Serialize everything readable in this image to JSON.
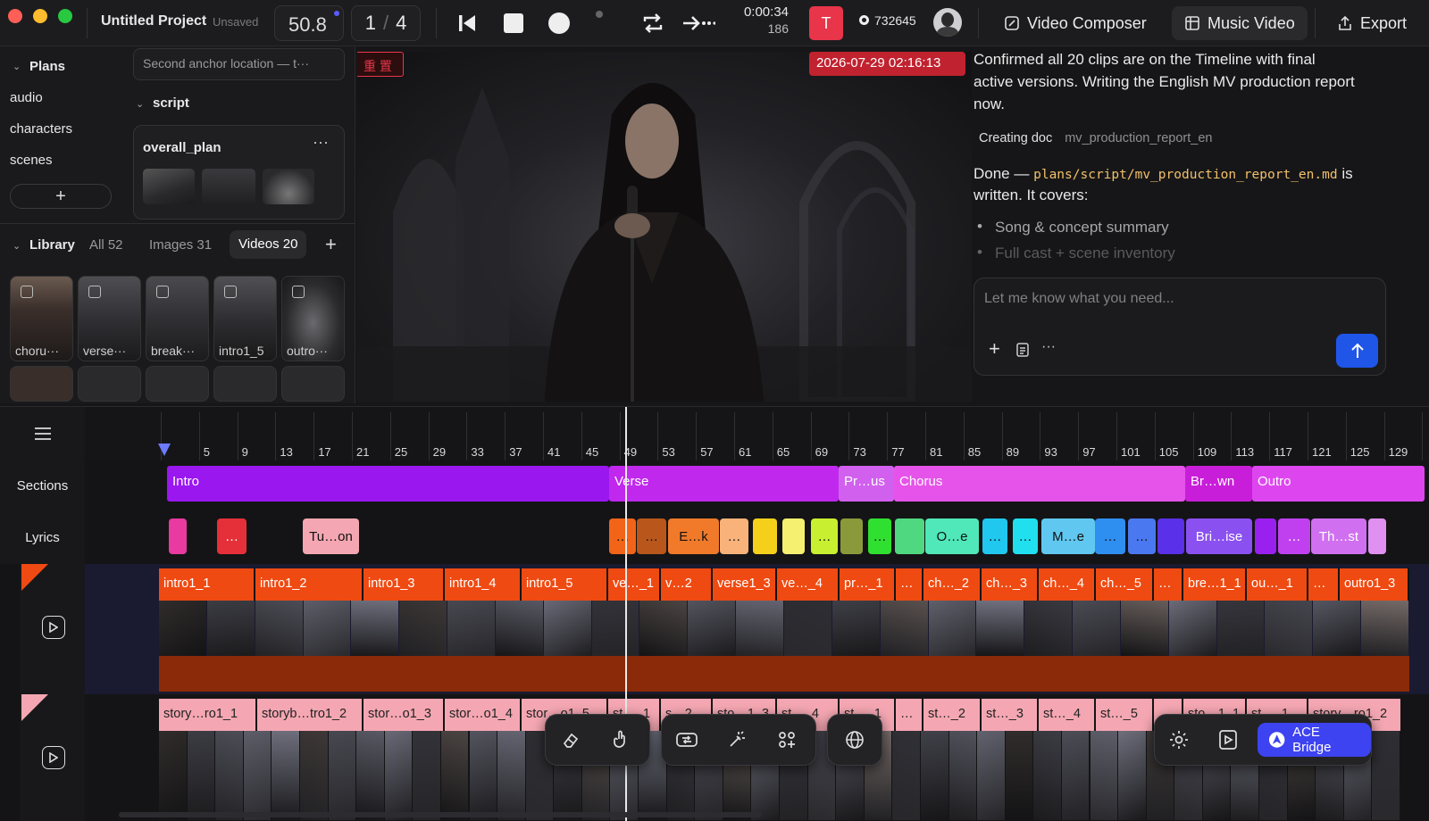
{
  "window": {
    "project_title": "Untitled Project",
    "save_status": "Unsaved",
    "fps": "50.8",
    "page_current": "1",
    "page_sep": "/",
    "page_total": "4",
    "time": "0:00:34",
    "frame": "186",
    "avatar_letter": "T",
    "credits": "732645"
  },
  "tabs": [
    {
      "label": "Video Composer",
      "icon": "composer-icon"
    },
    {
      "label": "Music Video",
      "icon": "grid-icon"
    }
  ],
  "export_label": "Export",
  "sidebar": {
    "search_placeholder": "Second anchor location — t···",
    "plans_label": "Plans",
    "plan_items": [
      "audio",
      "characters",
      "scenes"
    ],
    "script_label": "script",
    "overall_plan_label": "overall_plan",
    "library_label": "Library",
    "filters": [
      "All 52",
      "Images 31",
      "Videos 20"
    ],
    "thumbs": [
      "choru···",
      "verse···",
      "break···",
      "intro1_5",
      "outro···"
    ]
  },
  "preview": {
    "badge": "重 置",
    "timestamp": "2026-07-29 02:16:13"
  },
  "chat": {
    "message1": "Confirmed all 20 clips are on the Timeline with final active versions. Writing the English MV production report now.",
    "creating_label": "Creating doc",
    "creating_doc": "mv_production_report_en",
    "done_prefix": "Done —",
    "done_path": "plans/script/mv_production_report_en.md",
    "done_suffix": "is",
    "done_line2": "written. It covers:",
    "bullets": [
      "Song & concept summary",
      "Full cast + scene inventory"
    ],
    "input_placeholder": "Let me know what you need..."
  },
  "timeline": {
    "row_sections": "Sections",
    "row_lyrics": "Lyrics",
    "ruler": [
      "5",
      "9",
      "13",
      "17",
      "21",
      "25",
      "29",
      "33",
      "37",
      "41",
      "45",
      "49",
      "53",
      "57",
      "61",
      "65",
      "69",
      "73",
      "77",
      "81",
      "85",
      "89",
      "93",
      "97",
      "101",
      "105",
      "109",
      "113",
      "117",
      "121",
      "125",
      "129"
    ],
    "sections": [
      "Intro",
      "Verse",
      "Pr…us",
      "Chorus",
      "Br…wn",
      "Outro"
    ],
    "lyrics": [
      "…",
      "Tu…on",
      "…",
      "…",
      "E…k",
      "…",
      "…",
      "…",
      "O…e",
      "…",
      "…",
      "M…e",
      "…",
      "…",
      "Bri…ise",
      "…",
      "Th…st"
    ],
    "video_clips": [
      "intro1_1",
      "intro1_2",
      "intro1_3",
      "intro1_4",
      "intro1_5",
      "ve…_1",
      "v…2",
      "verse1_3",
      "ve…_4",
      "pr…_1",
      "…",
      "ch…_2",
      "ch…_3",
      "ch…_4",
      "ch…_5",
      "…",
      "bre…1_1",
      "ou…_1",
      "…",
      "outro1_3"
    ],
    "story_clips": [
      "story…ro1_1",
      "storyb…tro1_2",
      "stor…o1_3",
      "stor…o1_4",
      "stor…o1_5",
      "st…_1",
      "s…2",
      "sto…1_3",
      "st…_4",
      "st…_1",
      "…",
      "st…_2",
      "st…_3",
      "st…_4",
      "st…_5",
      "…",
      "sto…1_1",
      "st…_1",
      "story…ro1_2"
    ],
    "ace_bridge": "ACE Bridge"
  },
  "colors": {
    "accent_blue": "#1f56e8",
    "orange_clip": "#ef4a12",
    "pink_clip": "#f4a7b2",
    "intro": "#9a17f0",
    "verse": "#c028ee",
    "prechorus": "#d160ee",
    "chorus": "#e653ea",
    "bridge": "#c91ed9",
    "outro": "#dd46ef",
    "record_red": "#e8354a"
  }
}
